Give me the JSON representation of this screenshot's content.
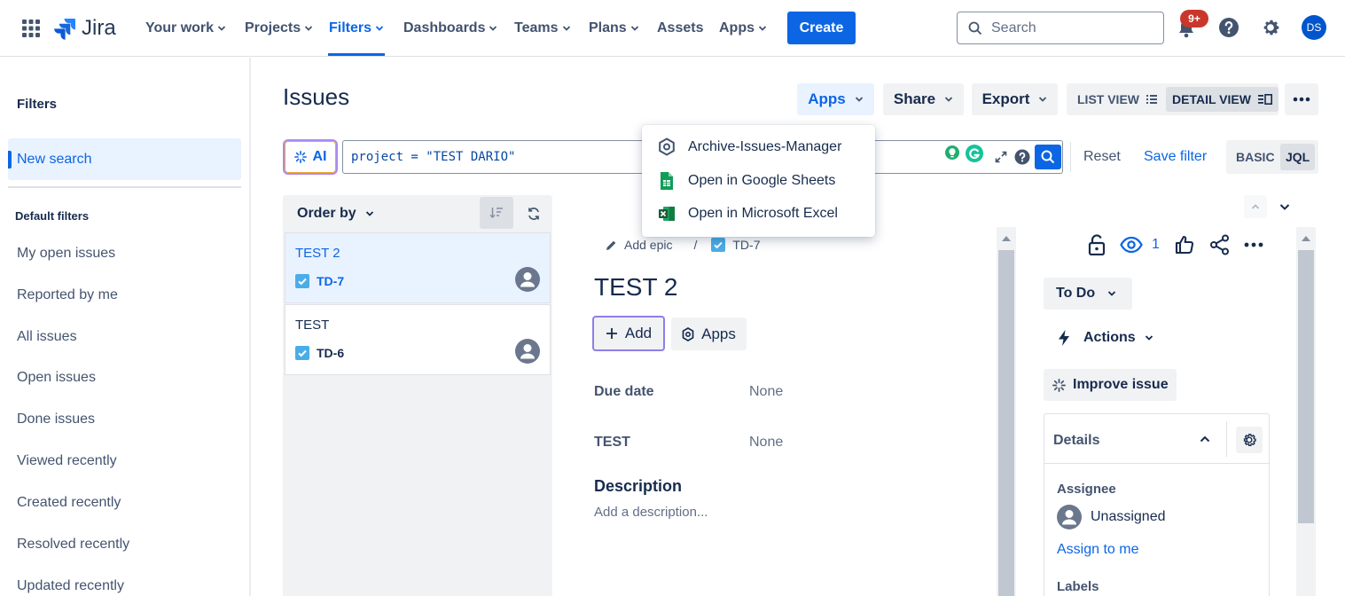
{
  "nav": {
    "brand": "Jira",
    "items": [
      {
        "label": "Your work",
        "dropdown": true
      },
      {
        "label": "Projects",
        "dropdown": true
      },
      {
        "label": "Filters",
        "dropdown": true,
        "active": true
      },
      {
        "label": "Dashboards",
        "dropdown": true
      },
      {
        "label": "Teams",
        "dropdown": true
      },
      {
        "label": "Plans",
        "dropdown": true
      },
      {
        "label": "Assets",
        "dropdown": false
      },
      {
        "label": "Apps",
        "dropdown": true
      }
    ],
    "create_label": "Create",
    "search_placeholder": "Search",
    "notification_badge": "9+",
    "user_initials": "DS",
    "accent_color": "#0c66e4"
  },
  "sidebar": {
    "title": "Filters",
    "new_search": "New search",
    "section_title": "Default filters",
    "items": [
      "My open issues",
      "Reported by me",
      "All issues",
      "Open issues",
      "Done issues",
      "Viewed recently",
      "Created recently",
      "Resolved recently",
      "Updated recently"
    ]
  },
  "header": {
    "title": "Issues",
    "apps_label": "Apps",
    "share_label": "Share",
    "export_label": "Export",
    "list_view_label": "LIST VIEW",
    "detail_view_label": "DETAIL VIEW"
  },
  "jql": {
    "ai_label": "AI",
    "query": "project = \"TEST DARIO\"",
    "reset_label": "Reset",
    "save_filter_label": "Save filter",
    "basic_label": "BASIC",
    "jql_label": "JQL"
  },
  "apps_menu": {
    "items": [
      {
        "label": "Archive-Issues-Manager",
        "icon": "hexagon-icon"
      },
      {
        "label": "Open in Google Sheets",
        "icon": "google-sheets-icon"
      },
      {
        "label": "Open in Microsoft Excel",
        "icon": "excel-icon"
      }
    ]
  },
  "issue_list": {
    "order_by_label": "Order by",
    "issues": [
      {
        "title": "TEST 2",
        "key": "TD-7",
        "selected": true
      },
      {
        "title": "TEST",
        "key": "TD-6",
        "selected": false
      }
    ]
  },
  "detail": {
    "add_epic_label": "Add epic",
    "breadcrumb_sep": "/",
    "issue_key": "TD-7",
    "title": "TEST 2",
    "add_label": "Add",
    "apps_label": "Apps",
    "fields": [
      {
        "label": "Due date",
        "value": "None"
      },
      {
        "label": "TEST",
        "value": "None"
      }
    ],
    "description_title": "Description",
    "description_placeholder": "Add a description..."
  },
  "side_panel": {
    "watchers_count": "1",
    "status_label": "To Do",
    "actions_label": "Actions",
    "improve_label": "Improve issue",
    "details_title": "Details",
    "assignee_label": "Assignee",
    "assignee_value": "Unassigned",
    "assign_to_me_label": "Assign to me",
    "labels_label": "Labels"
  }
}
